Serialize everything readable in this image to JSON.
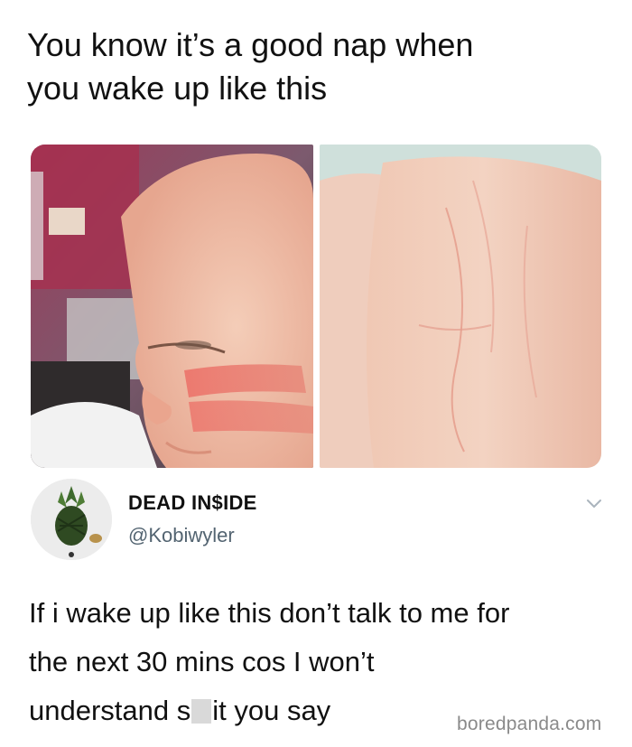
{
  "caption": {
    "line1": "You know it’s a good nap when",
    "line2": "you wake up like this"
  },
  "photos": {
    "left_icon": "baby-face-photo",
    "right_icon": "arm-skin-photo"
  },
  "tweet": {
    "display_name": "DEAD IN$IDE",
    "handle": "@Kobiwyler",
    "avatar_icon": "pineapple-avatar",
    "menu_icon": "chevron-down-icon",
    "text_line1": "If i wake up like this don’t talk to me for",
    "text_line2": "the next 30 mins cos I won’t",
    "text_line3_before": "understand s",
    "text_line3_after": "it you say"
  },
  "watermark": "boredpanda.com"
}
